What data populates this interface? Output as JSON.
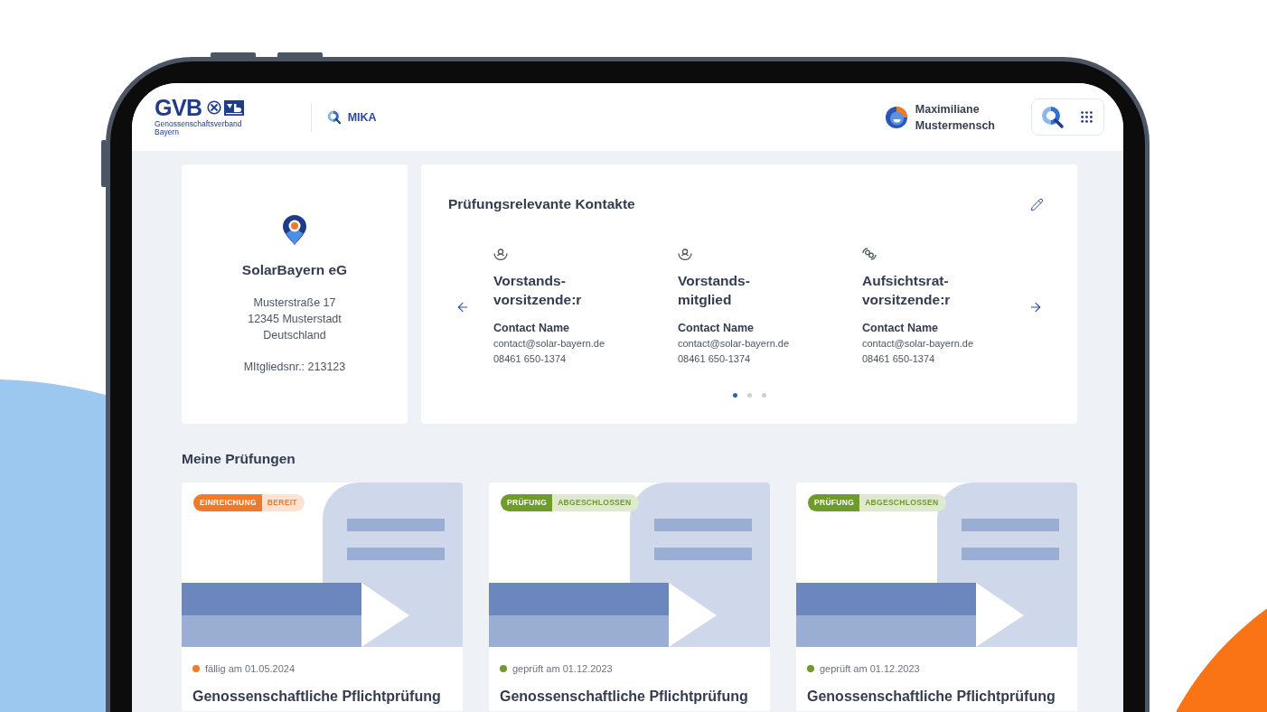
{
  "header": {
    "logo": {
      "wordmark": "GVB",
      "subtitle": "Genossenschaftsverband Bayern"
    },
    "app_name": "MIKA",
    "user": {
      "name": "Maximiliane Mustermensch"
    }
  },
  "member_card": {
    "name": "SolarBayern eG",
    "address": [
      "Musterstraße 17",
      "12345 Musterstadt",
      "Deutschland"
    ],
    "member_number": "MItgliedsnr.: 213123"
  },
  "contacts": {
    "title": "Prüfungsrelevante Kontakte",
    "items": [
      {
        "kind": "person",
        "role": "Vorstands-vorsitzende:r",
        "name": "Contact Name",
        "email": "contact@solar-bayern.de",
        "phone": "08461 650-1374"
      },
      {
        "kind": "person",
        "role": "Vorstands-mitglied",
        "name": "Contact Name",
        "email": "contact@solar-bayern.de",
        "phone": "08461 650-1374"
      },
      {
        "kind": "rings",
        "role": "Aufsichtsrat-vorsitzende:r",
        "name": "Contact Name",
        "email": "contact@solar-bayern.de",
        "phone": "08461 650-1374"
      }
    ],
    "pages": [
      {
        "selected": true
      },
      {
        "selected": false
      },
      {
        "selected": false
      }
    ]
  },
  "audits": {
    "title": "Meine Prüfungen",
    "cards": [
      {
        "badge": {
          "category": "EINREICHUNG",
          "status": "BEREIT"
        },
        "color": "#f07a2a",
        "date": "fällig am 01.05.2024",
        "title": "Genossenschaftliche Pflichtprüfung"
      },
      {
        "badge": {
          "category": "PRÜFUNG",
          "status": "ABGESCHLOSSEN"
        },
        "color": "#6e9b2b",
        "date": "geprüft am 01.12.2023",
        "title": "Genossenschaftliche Pflichtprüfung"
      },
      {
        "badge": {
          "category": "PRÜFUNG",
          "status": "ABGESCHLOSSEN"
        },
        "color": "#6e9b2b",
        "date": "geprüft am 01.12.2023",
        "title": "Genossenschaftliche Pflichtprüfung"
      }
    ]
  }
}
